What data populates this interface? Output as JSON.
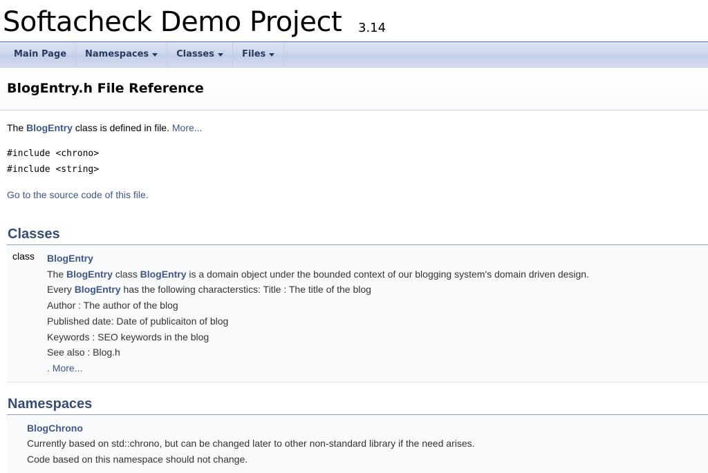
{
  "project": {
    "name": "Softacheck Demo Project",
    "number": "3.14"
  },
  "nav": {
    "items": [
      {
        "label": "Main Page"
      },
      {
        "label": "Namespaces"
      },
      {
        "label": "Classes"
      },
      {
        "label": "Files"
      }
    ]
  },
  "page": {
    "title": "BlogEntry.h File Reference",
    "brief": {
      "pre": "The ",
      "link": "BlogEntry",
      "post": " class is defined in file. ",
      "more": "More..."
    },
    "includes": [
      "#include <chrono>",
      "#include <string>"
    ],
    "source_link": "Go to the source code of this file."
  },
  "classes": {
    "title": "Classes",
    "keyword": "class",
    "name": "BlogEntry",
    "desc_line1": {
      "t1": "The ",
      "l1": "BlogEntry",
      "t2": " class ",
      "l2": "BlogEntry",
      "t3": " is a domain object under the bounded context of our blogging system's domain driven design."
    },
    "desc_line2": {
      "t1": "Every ",
      "l1": "BlogEntry",
      "t2": " has the following characterstics: Title : The title of the blog"
    },
    "desc_line3": "Author : The author of the blog",
    "desc_line4": "Published date: Date of publicaiton of blog",
    "desc_line5": "Keywords : SEO keywords in the blog",
    "desc_line6": "See also : Blog.h",
    "more": ". More..."
  },
  "namespaces": {
    "title": "Namespaces",
    "name": "BlogChrono",
    "desc_line1": "Currently based on std::chrono, but can be changed later to other non-standard library if the need arises.",
    "desc_line2": "Code based on this namespace should not change."
  }
}
